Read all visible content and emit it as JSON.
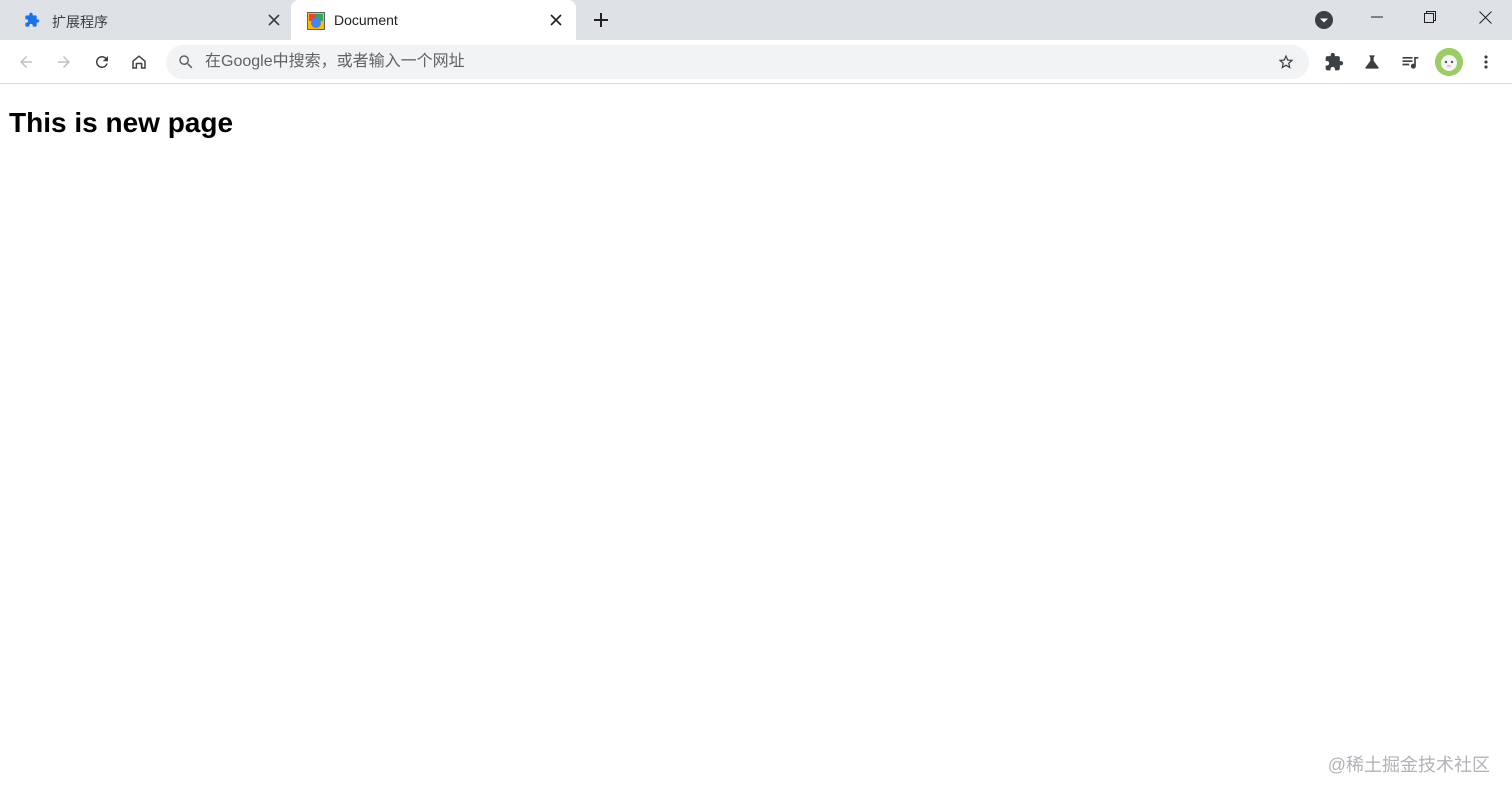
{
  "tabs": [
    {
      "title": "扩展程序",
      "active": false,
      "favicon": "puzzle-icon"
    },
    {
      "title": "Document",
      "active": true,
      "favicon": "document-favicon-icon"
    }
  ],
  "omnibox": {
    "placeholder": "在Google中搜索，或者输入一个网址",
    "value": ""
  },
  "page": {
    "heading": "This is new page"
  },
  "watermark": "@稀土掘金技术社区",
  "colors": {
    "tabstrip": "#dee1e6",
    "omnibox": "#f1f3f4",
    "icon": "#5f6368",
    "accent": "#1a73e8"
  }
}
